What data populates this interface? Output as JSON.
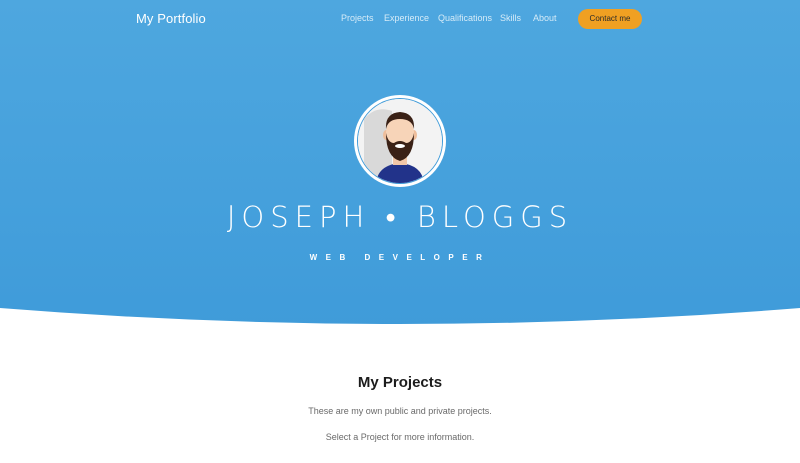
{
  "navbar": {
    "brand": "My Portfolio",
    "links": [
      "Projects",
      "Experience",
      "Qualifications",
      "Skills",
      "About"
    ],
    "contact_label": "Contact me"
  },
  "hero": {
    "name": "JOSEPH • BLOGGS",
    "title": "WEB DEVELOPER",
    "avatar_icon": "bearded-man-avatar"
  },
  "projects": {
    "heading": "My Projects",
    "line1": "These are my own public and private projects.",
    "line2": "Select a Project for more information."
  },
  "colors": {
    "hero_bg": "#4ea7df",
    "accent_button": "#f0a022",
    "text_dark": "#1c1c1c",
    "text_muted": "#6a6a6a"
  }
}
